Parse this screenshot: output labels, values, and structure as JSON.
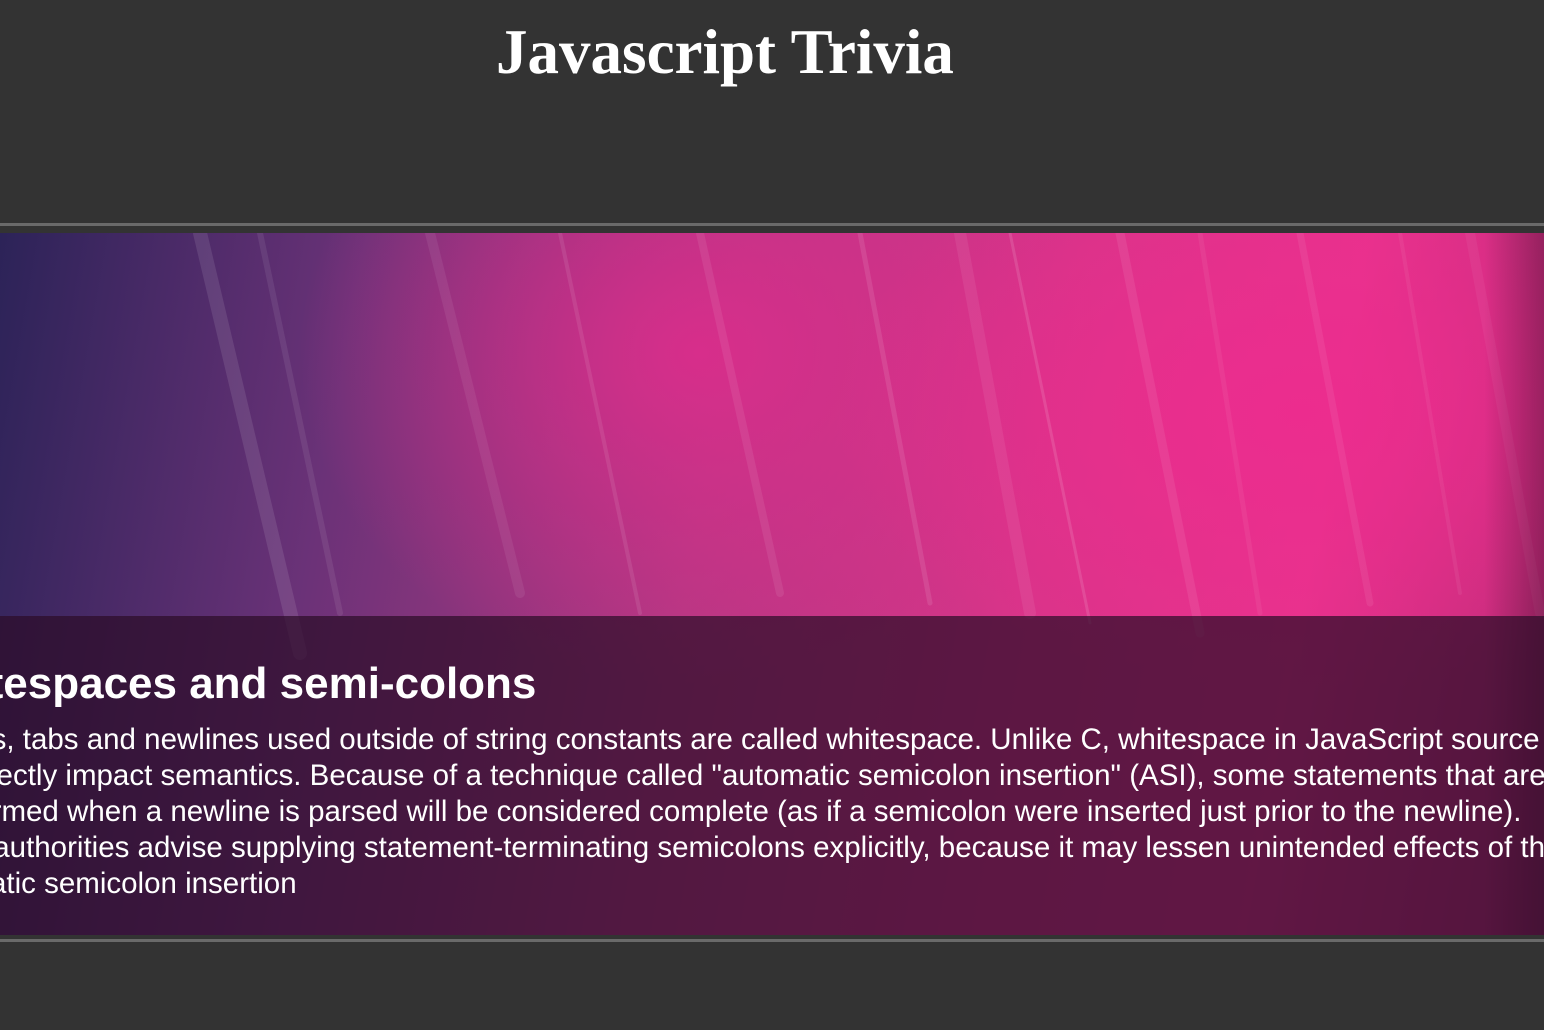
{
  "header": {
    "title": "Javascript Trivia"
  },
  "slide": {
    "heading": "Whitespaces and semi-colons",
    "body_lines": [
      "Spaces, tabs and newlines used outside of string constants are called whitespace. Unlike C, whitespace in JavaScript source",
      "can directly impact semantics. Because of a technique called \"automatic semicolon insertion\" (ASI), some statements that are",
      "well formed when a newline is parsed will be considered complete (as if a semicolon were inserted just prior to the newline).",
      "Some authorities advise supplying statement-terminating semicolons explicitly, because it may lessen unintended effects of the",
      "automatic semicolon insertion"
    ]
  },
  "colors": {
    "page_background": "#333333",
    "rule": "#6a6a6a",
    "accent_pink": "#e8338d",
    "accent_purple": "#2c2358"
  }
}
